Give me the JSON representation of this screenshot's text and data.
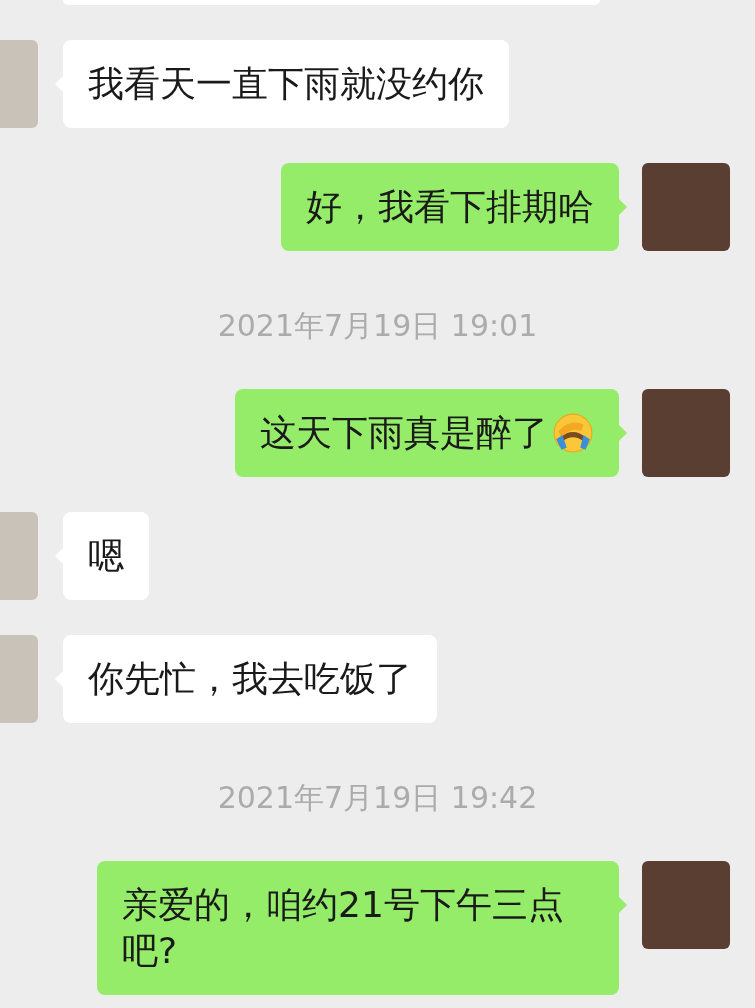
{
  "messages": [
    {
      "kind": "clipped",
      "outgoing": false
    },
    {
      "kind": "message",
      "outgoing": false,
      "text": "我看天一直下雨就没约你"
    },
    {
      "kind": "message",
      "outgoing": true,
      "text": "好，我看下排期哈"
    },
    {
      "kind": "time",
      "text": "2021年7月19日 19:01"
    },
    {
      "kind": "message",
      "outgoing": true,
      "text": "这天下雨真是醉了",
      "emoji": true
    },
    {
      "kind": "message",
      "outgoing": false,
      "text": "嗯"
    },
    {
      "kind": "message",
      "outgoing": false,
      "text": "你先忙，我去吃饭了"
    },
    {
      "kind": "time",
      "text": "2021年7月19日 19:42"
    },
    {
      "kind": "message",
      "outgoing": true,
      "text": "亲爱的，咱约21号下午三点吧?"
    }
  ]
}
